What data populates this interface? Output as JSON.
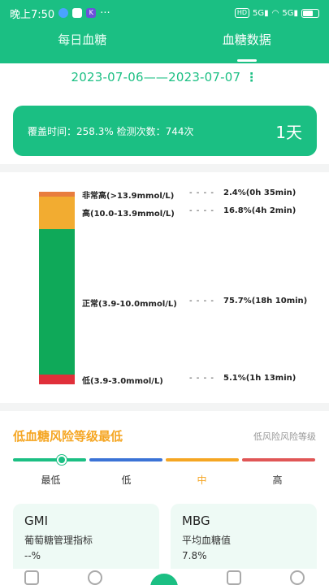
{
  "status_bar": {
    "time": "晚上7:50",
    "dots": "···",
    "battery": "59"
  },
  "tabs": [
    {
      "label": "每日血糖"
    },
    {
      "label": "血糖数据"
    }
  ],
  "date_range": {
    "text": "2023-07-06——2023-07-07",
    "more": "⋮"
  },
  "coverage": {
    "info": "覆盖时间：258.3% 检测次数：744次",
    "days": "1天"
  },
  "ranges": [
    {
      "label": "非常高(>13.9mmol/L)",
      "dash": "- - - -",
      "value": "2.4%(0h 35min)",
      "percent": 2.4,
      "color": "#e87d3e"
    },
    {
      "label": "高(10.0-13.9mmol/L)",
      "dash": "- - - -",
      "value": "16.8%(4h 2min)",
      "percent": 16.8,
      "color": "#f2ac31"
    },
    {
      "label": "正常(3.9-10.0mmol/L)",
      "dash": "- - - -",
      "value": "75.7%(18h 10min)",
      "percent": 75.7,
      "color": "#0fa959"
    },
    {
      "label": "低(3.9-3.0mmol/L)",
      "dash": "- - - -",
      "value": "5.1%(1h 13min)",
      "percent": 5.1,
      "color": "#e0303a"
    }
  ],
  "risk": {
    "title": "低血糖风险等级最低",
    "link": "低风险风险等级",
    "levels": [
      "最低",
      "低",
      "中",
      "高"
    ],
    "highlight_index": 2,
    "colors": [
      "#1bbf83",
      "#3b73d6",
      "#f5a623",
      "#e05656"
    ],
    "current_level": 0.16
  },
  "metrics": [
    {
      "name": "GMI",
      "desc": "葡萄糖管理指标",
      "value": "--%"
    },
    {
      "name": "MBG",
      "desc": "平均血糖值",
      "value": "7.8%"
    }
  ]
}
